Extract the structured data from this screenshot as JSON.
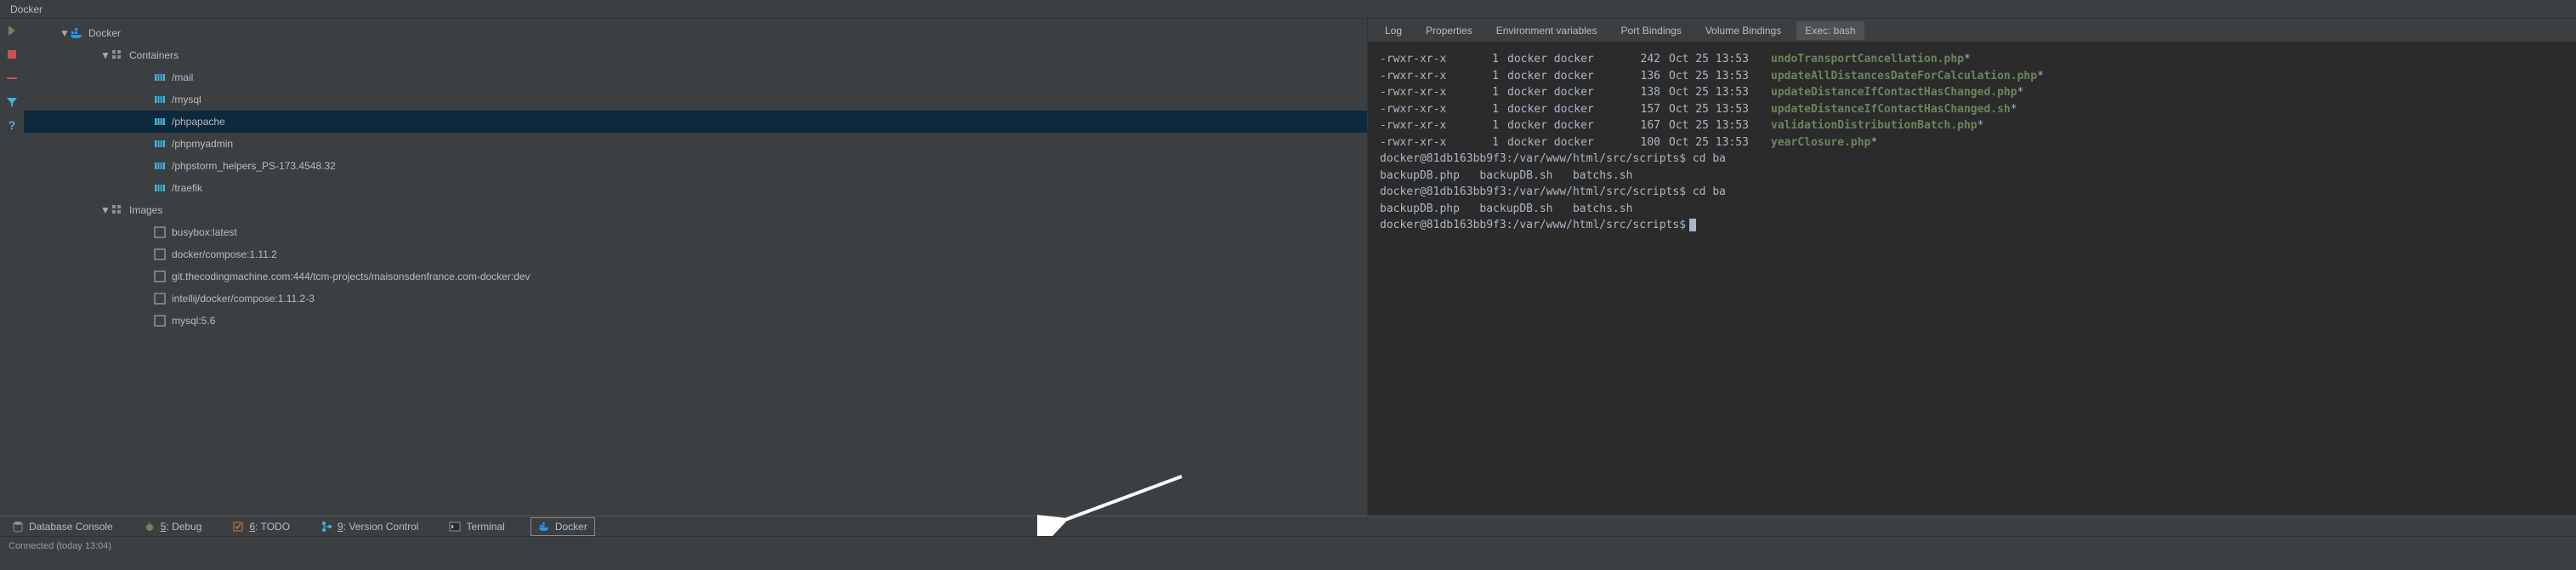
{
  "panel": {
    "title": "Docker"
  },
  "tree": {
    "root": "Docker",
    "containers_label": "Containers",
    "containers": [
      "/mail",
      "/mysql",
      "/phpapache",
      "/phpmyadmin",
      "/phpstorm_helpers_PS-173.4548.32",
      "/traefik"
    ],
    "selected_container": "/phpapache",
    "images_label": "Images",
    "images": [
      "busybox:latest",
      "docker/compose:1.11.2",
      "git.thecodingmachine.com:444/tcm-projects/maisonsdenfrance.com-docker:dev",
      "intellij/docker/compose:1.11.2-3",
      "mysql:5.6"
    ]
  },
  "tabs": {
    "items": [
      "Log",
      "Properties",
      "Environment variables",
      "Port Bindings",
      "Volume Bindings",
      "Exec: bash"
    ],
    "active": 5
  },
  "terminal": {
    "listing": [
      {
        "perm": "-rwxr-xr-x",
        "links": "1",
        "owner": "docker",
        "group": "docker",
        "size": "242",
        "date": "Oct 25 13:53",
        "name": "undoTransportCancellation.php"
      },
      {
        "perm": "-rwxr-xr-x",
        "links": "1",
        "owner": "docker",
        "group": "docker",
        "size": "136",
        "date": "Oct 25 13:53",
        "name": "updateAllDistancesDateForCalculation.php"
      },
      {
        "perm": "-rwxr-xr-x",
        "links": "1",
        "owner": "docker",
        "group": "docker",
        "size": "138",
        "date": "Oct 25 13:53",
        "name": "updateDistanceIfContactHasChanged.php"
      },
      {
        "perm": "-rwxr-xr-x",
        "links": "1",
        "owner": "docker",
        "group": "docker",
        "size": "157",
        "date": "Oct 25 13:53",
        "name": "updateDistanceIfContactHasChanged.sh"
      },
      {
        "perm": "-rwxr-xr-x",
        "links": "1",
        "owner": "docker",
        "group": "docker",
        "size": "167",
        "date": "Oct 25 13:53",
        "name": "validationDistributionBatch.php"
      },
      {
        "perm": "-rwxr-xr-x",
        "links": "1",
        "owner": "docker",
        "group": "docker",
        "size": "100",
        "date": "Oct 25 13:53",
        "name": "yearClosure.php"
      }
    ],
    "prompt": "docker@81db163bb9f3:/var/www/html/src/scripts$",
    "cmd1": "cd ba",
    "completion": "backupDB.php   backupDB.sh   batchs.sh",
    "cmd2": "cd ba"
  },
  "bottombar": {
    "items": [
      {
        "label": "Database Console",
        "icon": "db"
      },
      {
        "label": "5: Debug",
        "icon": "bug",
        "num": "5"
      },
      {
        "label": "6: TODO",
        "icon": "todo",
        "num": "6"
      },
      {
        "label": "9: Version Control",
        "icon": "vcs",
        "num": "9"
      },
      {
        "label": "Terminal",
        "icon": "term"
      },
      {
        "label": "Docker",
        "icon": "docker",
        "boxed": true
      }
    ]
  },
  "status": {
    "text": "Connected (today 13:04)"
  },
  "colors": {
    "bg": "#3c3f41",
    "termbg": "#2b2b2b",
    "selection": "#0d293e",
    "exec_green": "#6a8759",
    "container_blue": "#40b6e0",
    "docker_whale": "#2496ed"
  }
}
